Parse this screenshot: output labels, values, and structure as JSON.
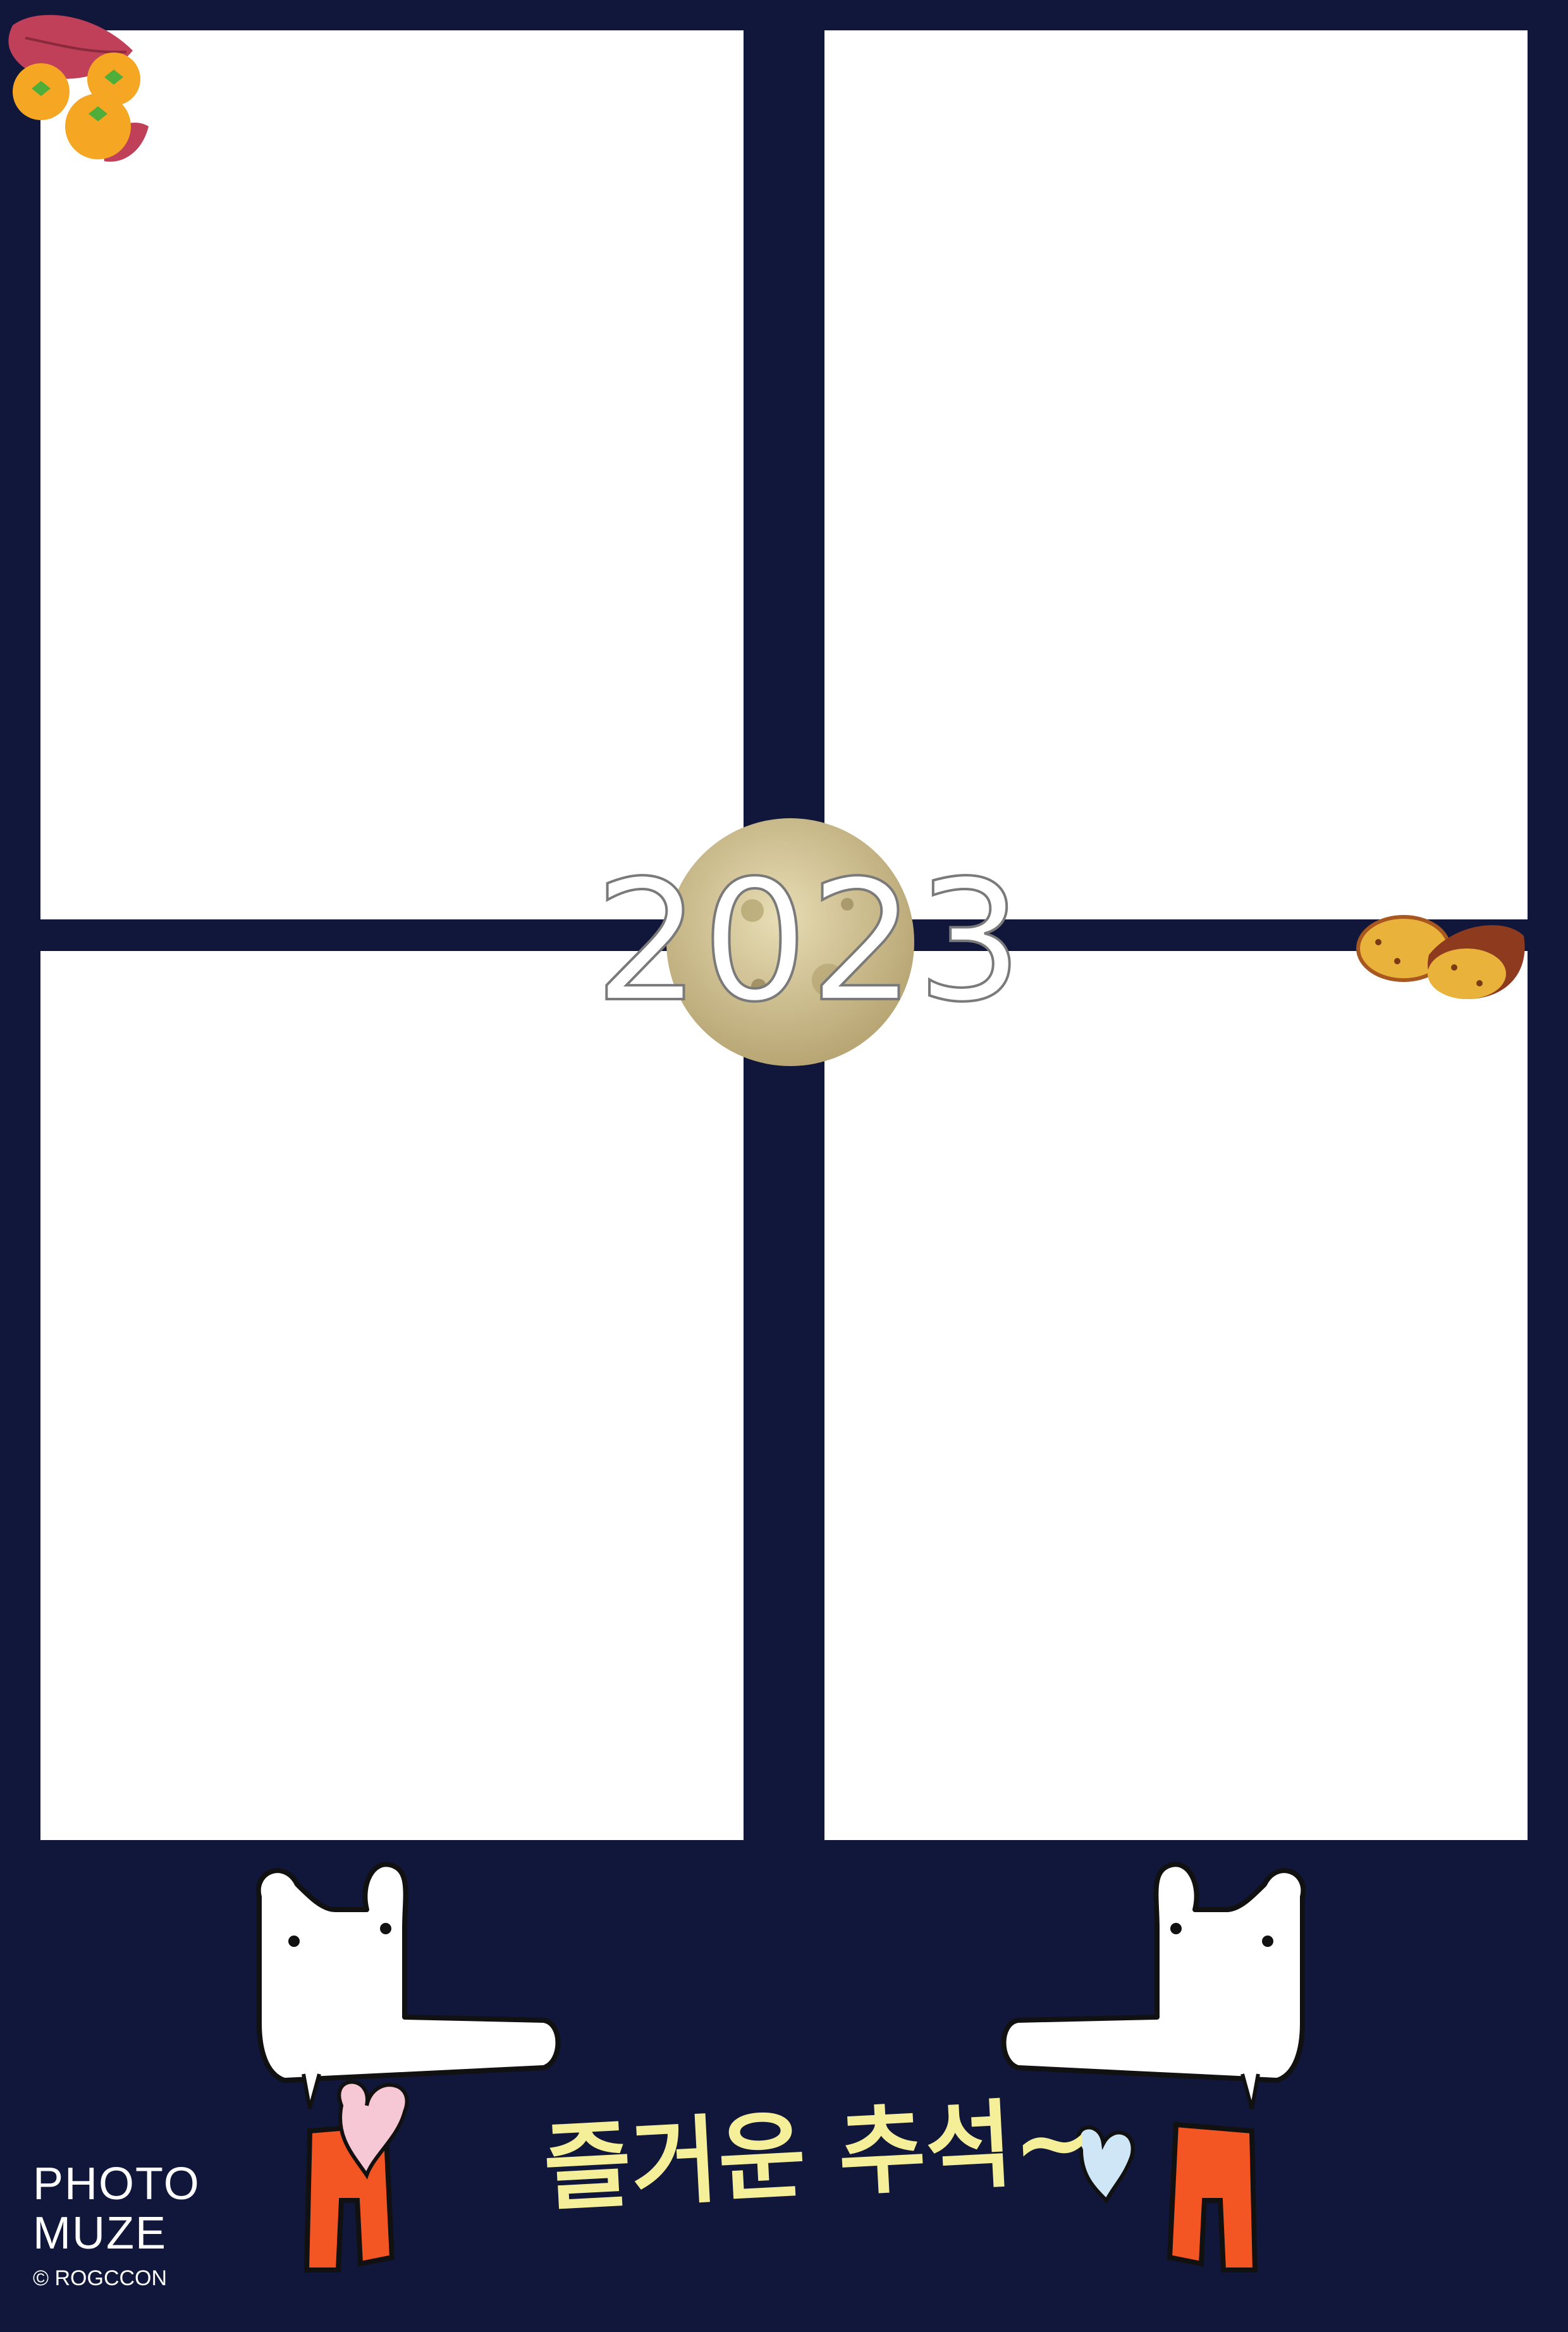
{
  "frame": {
    "background_color": "#11173a",
    "slot_color": "#ffffff",
    "slot_count": 4
  },
  "center_badge": {
    "year": "2023",
    "moon_color": "#cdbf92"
  },
  "greeting": {
    "text": "즐거운 추석~",
    "color": "#f6ef9a"
  },
  "brand": {
    "line1": "PHOTO",
    "line2": "MUZE",
    "copyright": "© ROGCCON"
  },
  "decorations": {
    "top_left": "persimmon-leaves-icon",
    "right": "sweet-potato-icon",
    "left_character": "dog-with-pink-heart-icon",
    "right_character": "dog-with-blue-heart-icon"
  }
}
